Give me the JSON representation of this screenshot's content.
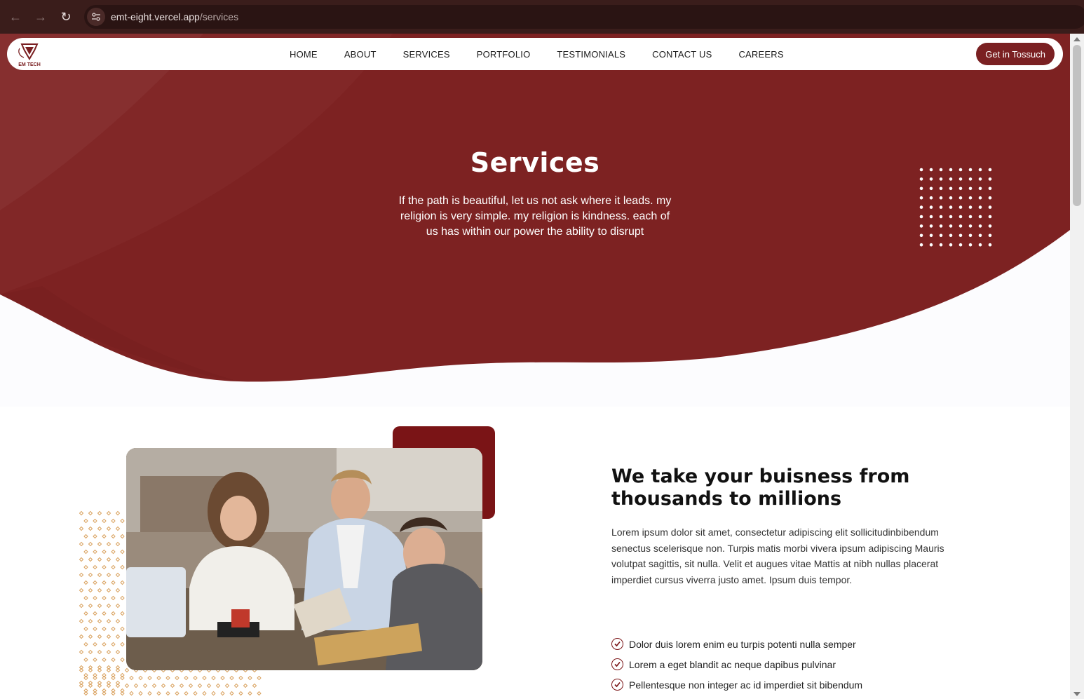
{
  "browser": {
    "url_host": "emt-eight.vercel.app",
    "url_path": "/services",
    "icons": {
      "back": "arrow-left-icon",
      "forward": "arrow-right-icon",
      "reload": "reload-icon",
      "site_info": "tune-icon"
    }
  },
  "nav": {
    "logo_text": "EM TECH",
    "links": [
      "HOME",
      "ABOUT",
      "SERVICES",
      "PORTFOLIO",
      "TESTIMONIALS",
      "CONTACT US",
      "CAREERS"
    ],
    "cta_label": "Get in Tossuch"
  },
  "hero": {
    "title": "Services",
    "subtitle": "If the path is beautiful, let us not ask where it leads. my religion is very simple. my religion is kindness. each of us has within our power the ability to disrupt"
  },
  "feature": {
    "title": "We take your buisness from thousands to millions",
    "body": "Lorem ipsum dolor sit amet, consectetur adipiscing elit sollicitudinbibendum senectus scelerisque non. Turpis matis morbi vivera ipsum adipiscing Mauris volutpat sagittis, sit nulla. Velit et augues vitae Mattis at nibh nullas placerat imperdiet cursus viverra justo amet. Ipsum duis tempor.",
    "checklist": [
      "Dolor duis lorem enim eu turpis potenti nulla semper",
      "Lorem a eget blandit ac neque dapibus pulvinar",
      "Pellentesque non integer ac id imperdiet sit bibendum"
    ]
  },
  "colors": {
    "brand": "#7a2022",
    "hero_bg": "#7d2222",
    "chrome": "#3a1d1b"
  }
}
